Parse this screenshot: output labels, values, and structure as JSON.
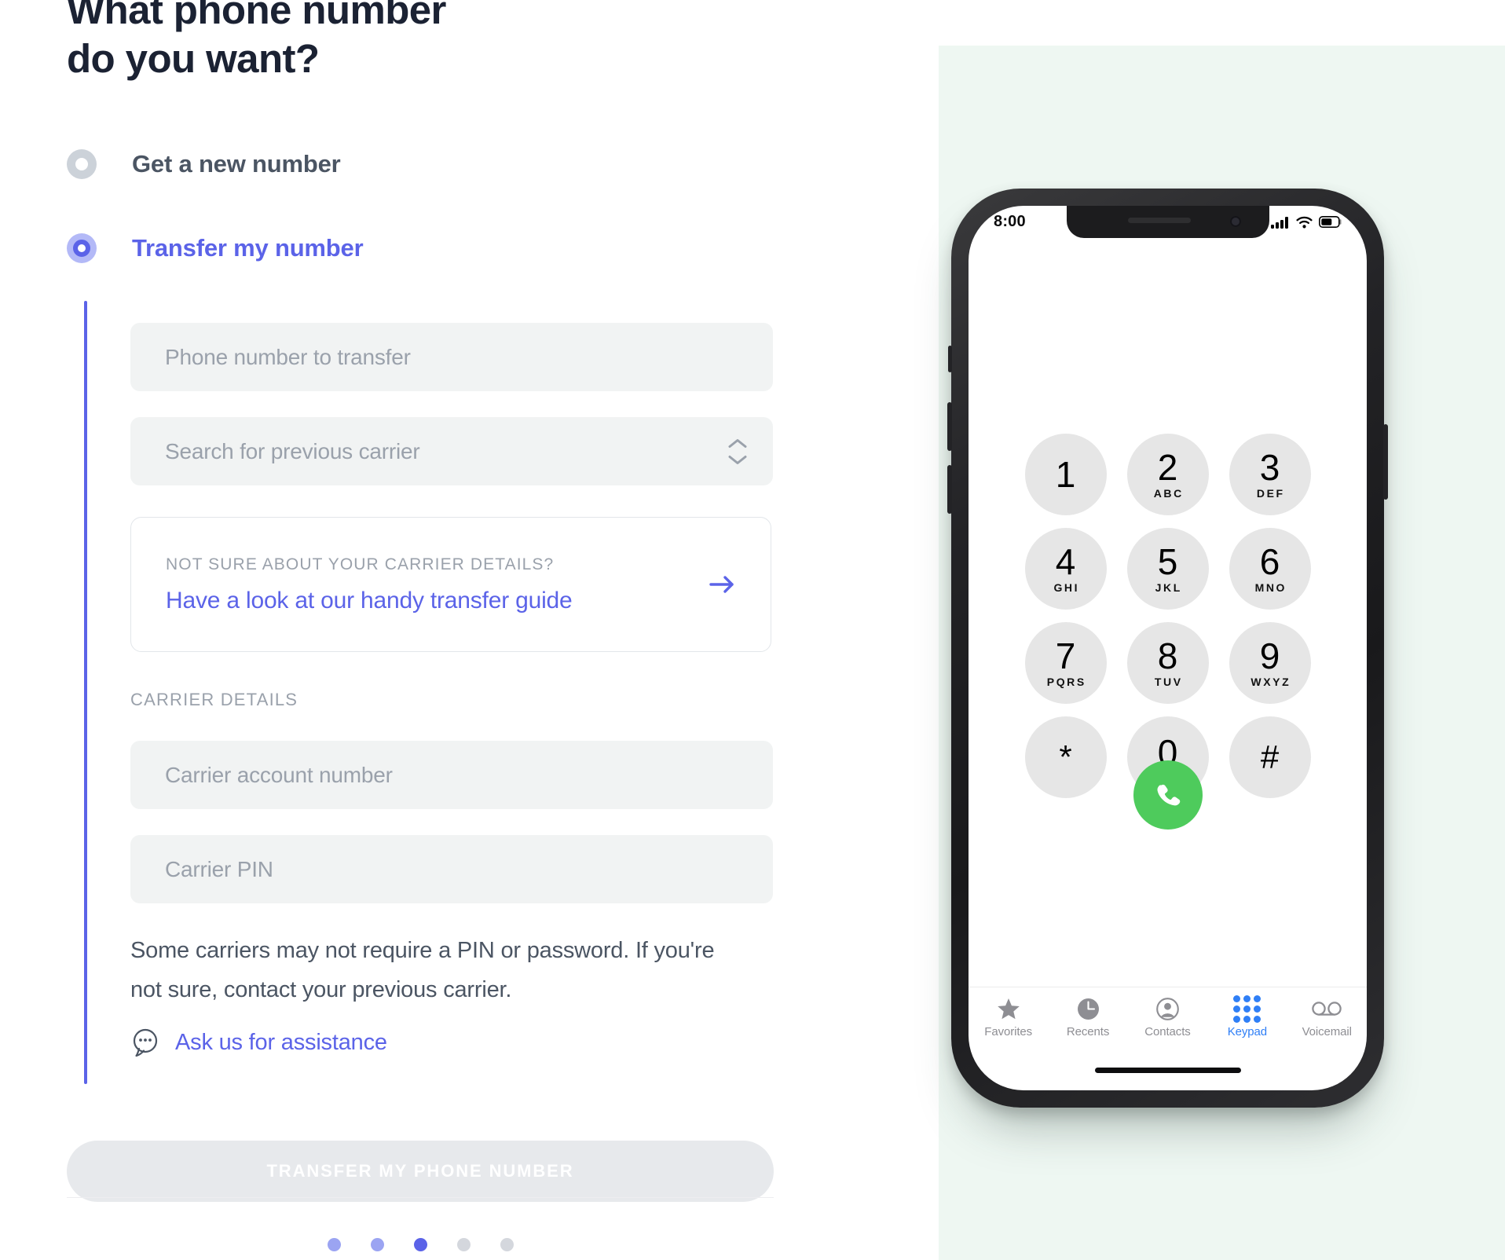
{
  "form": {
    "title_line1": "What phone number",
    "title_line2": "do you want?",
    "options": [
      {
        "label": "Get a new number",
        "selected": false
      },
      {
        "label": "Transfer my number",
        "selected": true
      }
    ],
    "fields": {
      "phone_placeholder": "Phone number to transfer",
      "carrier_placeholder": "Search for previous carrier",
      "account_placeholder": "Carrier account number",
      "pin_placeholder": "Carrier PIN"
    },
    "guide_card": {
      "kicker": "NOT SURE ABOUT YOUR CARRIER DETAILS?",
      "link": "Have a look at our handy transfer guide"
    },
    "section_label": "CARRIER DETAILS",
    "helper_text": "Some carriers may not require a PIN or password. If you're not sure, contact your previous carrier.",
    "assistance_link": "Ask us for assistance",
    "submit_label": "TRANSFER MY PHONE NUMBER",
    "pagination": {
      "total": 5,
      "active_index": 3,
      "states": [
        "done",
        "done",
        "active",
        "todo",
        "todo"
      ]
    }
  },
  "colors": {
    "accent": "#5b63e8",
    "accent_light": "#b3b9f7",
    "text_dark": "#1b2233",
    "text_muted": "#9aa1ab",
    "field_bg": "#f1f3f3",
    "panel_bg": "#eef7f2",
    "call_green": "#4ecb5c",
    "ios_blue": "#2f7ff6"
  },
  "phone": {
    "status": {
      "time": "8:00",
      "signal": "signal-bars",
      "wifi": "wifi-icon",
      "battery": "battery-icon"
    },
    "keypad": [
      {
        "num": "1",
        "letters": ""
      },
      {
        "num": "2",
        "letters": "ABC"
      },
      {
        "num": "3",
        "letters": "DEF"
      },
      {
        "num": "4",
        "letters": "GHI"
      },
      {
        "num": "5",
        "letters": "JKL"
      },
      {
        "num": "6",
        "letters": "MNO"
      },
      {
        "num": "7",
        "letters": "PQRS"
      },
      {
        "num": "8",
        "letters": "TUV"
      },
      {
        "num": "9",
        "letters": "WXYZ"
      },
      {
        "num": "*",
        "letters": ""
      },
      {
        "num": "0",
        "letters": "+"
      },
      {
        "num": "#",
        "letters": ""
      }
    ],
    "call_button": "call-button",
    "tabs": [
      {
        "label": "Favorites",
        "icon": "star-icon",
        "active": false
      },
      {
        "label": "Recents",
        "icon": "clock-icon",
        "active": false
      },
      {
        "label": "Contacts",
        "icon": "person-icon",
        "active": false
      },
      {
        "label": "Keypad",
        "icon": "keypad-dots-icon",
        "active": true
      },
      {
        "label": "Voicemail",
        "icon": "voicemail-icon",
        "active": false
      }
    ]
  }
}
